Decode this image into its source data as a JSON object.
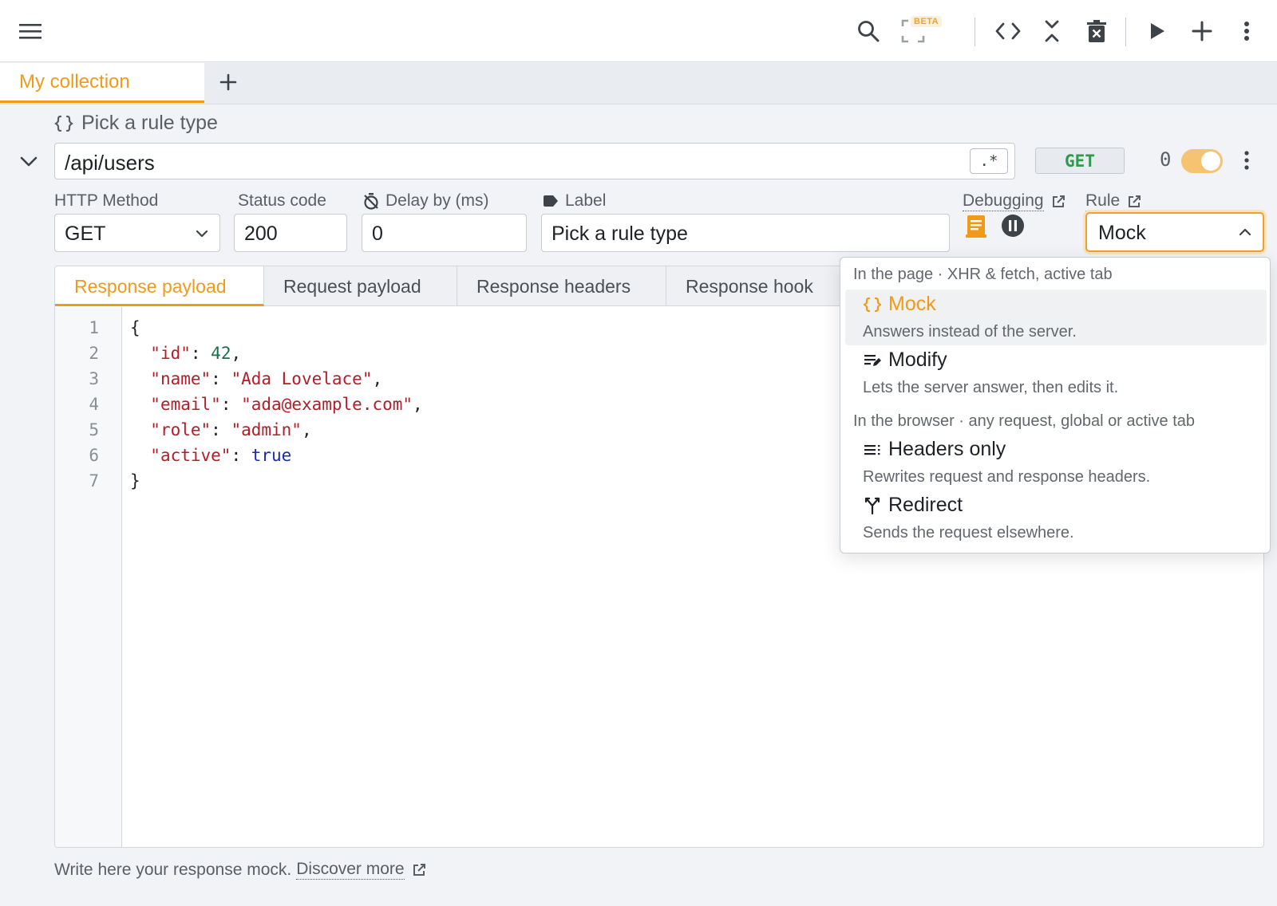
{
  "toolbar": {
    "beta_badge": "BETA"
  },
  "tabs": {
    "collection": "My collection"
  },
  "rule": {
    "title": "Pick a rule type",
    "url": "/api/users",
    "regex_toggle": ".*",
    "method_badge": "GET",
    "hit_count": "0",
    "enabled": true
  },
  "fields": {
    "http_method_label": "HTTP Method",
    "http_method_value": "GET",
    "status_label": "Status code",
    "status_value": "200",
    "delay_label": "Delay by (ms)",
    "delay_value": "0",
    "label_label": "Label",
    "label_value": "Pick a rule type",
    "debugging_label": "Debugging",
    "rule_label": "Rule",
    "rule_value": "Mock"
  },
  "editor": {
    "tabs": [
      "Response payload",
      "Request payload",
      "Response headers",
      "Response hook"
    ],
    "active_tab": 0,
    "line_numbers": [
      "1",
      "2",
      "3",
      "4",
      "5",
      "6",
      "7"
    ],
    "code": {
      "open": "{",
      "close": "}",
      "entries": [
        {
          "key": "\"id\"",
          "value": "42",
          "kind": "number"
        },
        {
          "key": "\"name\"",
          "value": "\"Ada Lovelace\"",
          "kind": "string"
        },
        {
          "key": "\"email\"",
          "value": "\"ada@example.com\"",
          "kind": "string"
        },
        {
          "key": "\"role\"",
          "value": "\"admin\"",
          "kind": "string"
        },
        {
          "key": "\"active\"",
          "value": "true",
          "kind": "boolean"
        }
      ]
    }
  },
  "hint": {
    "text": "Write here your response mock.",
    "link": "Discover more"
  },
  "dropdown": {
    "group1": "In the page · XHR & fetch, active tab",
    "group2": "In the browser · any request, global or active tab",
    "items": [
      {
        "icon": "braces-icon",
        "title": "Mock",
        "desc": "Answers instead of the server.",
        "selected": true
      },
      {
        "icon": "edit-lines-icon",
        "title": "Modify",
        "desc": "Lets the server answer, then edits it.",
        "selected": false
      },
      {
        "icon": "headers-icon",
        "title": "Headers only",
        "desc": "Rewrites request and response headers.",
        "selected": false
      },
      {
        "icon": "fork-icon",
        "title": "Redirect",
        "desc": "Sends the request elsewhere.",
        "selected": false
      }
    ]
  },
  "colors": {
    "accent": "#f19a1a",
    "method_green": "#2f9a4b",
    "toggle_on": "#f5c371"
  }
}
